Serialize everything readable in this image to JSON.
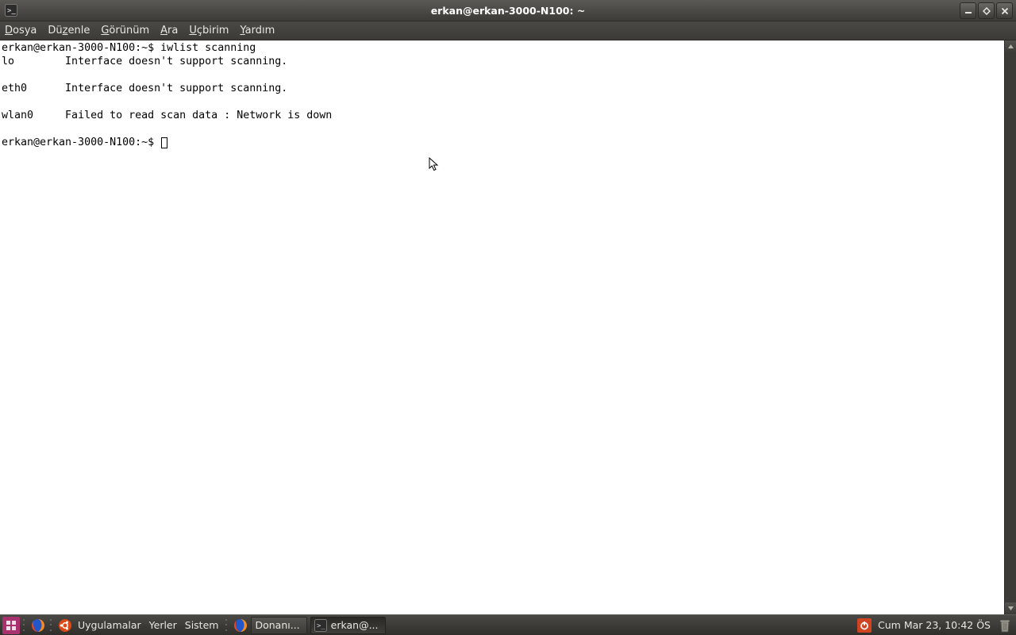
{
  "titlebar": {
    "title": "erkan@erkan-3000-N100: ~"
  },
  "menubar": {
    "items": [
      {
        "pre": "",
        "ul": "D",
        "post": "osya"
      },
      {
        "pre": "Dü",
        "ul": "z",
        "post": "enle"
      },
      {
        "pre": "",
        "ul": "G",
        "post": "örünüm"
      },
      {
        "pre": "",
        "ul": "A",
        "post": "ra"
      },
      {
        "pre": "",
        "ul": "U",
        "post": "çbirim"
      },
      {
        "pre": "",
        "ul": "Y",
        "post": "ardım"
      }
    ]
  },
  "terminal": {
    "prompt": "erkan@erkan-3000-N100:~$ ",
    "command": "iwlist scanning",
    "lines": [
      "lo        Interface doesn't support scanning.",
      "",
      "eth0      Interface doesn't support scanning.",
      "",
      "wlan0     Failed to read scan data : Network is down",
      ""
    ]
  },
  "taskbar": {
    "apps_label": "Uygulamalar",
    "places_label": "Yerler",
    "system_label": "Sistem",
    "task1_label": "Donanı...",
    "task2_label": "erkan@...",
    "clock": "Cum Mar 23, 10:42 ÖS"
  }
}
